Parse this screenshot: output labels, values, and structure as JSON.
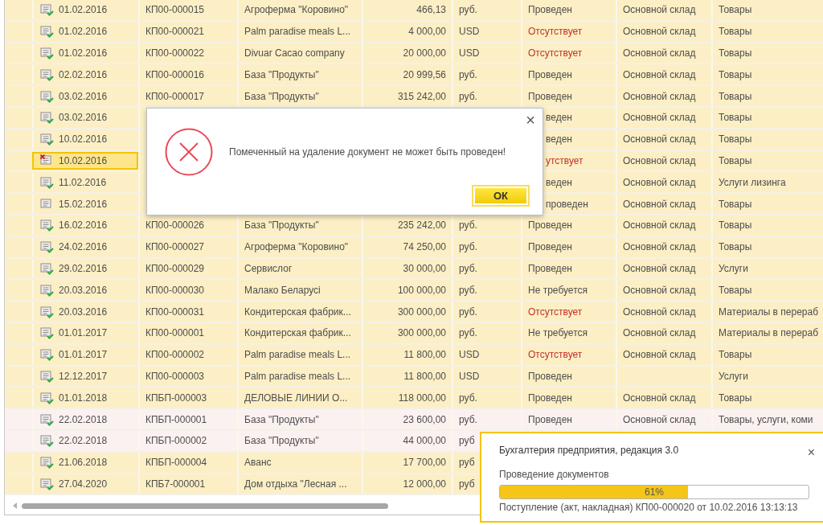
{
  "table": {
    "rows": [
      {
        "kind": "posted",
        "selected": false,
        "tinted": false,
        "date": "01.02.2016",
        "number": "КП00-000015",
        "counterparty": "Агроферма \"Коровино\"",
        "amount": "466,13",
        "currency": "руб.",
        "status": "Проведен",
        "status_alert": false,
        "warehouse": "Основной склад",
        "type": "Товары"
      },
      {
        "kind": "posted",
        "selected": false,
        "tinted": false,
        "date": "01.02.2016",
        "number": "КП00-000021",
        "counterparty": "Palm paradise meals L...",
        "amount": "4 000,00",
        "currency": "USD",
        "status": "Отсутствует",
        "status_alert": true,
        "warehouse": "Основной склад",
        "type": "Товары"
      },
      {
        "kind": "posted",
        "selected": false,
        "tinted": false,
        "date": "01.02.2016",
        "number": "КП00-000022",
        "counterparty": "Divuar Cacao company",
        "amount": "20 000,00",
        "currency": "USD",
        "status": "Отсутствует",
        "status_alert": true,
        "warehouse": "Основной склад",
        "type": "Товары"
      },
      {
        "kind": "posted",
        "selected": false,
        "tinted": false,
        "date": "02.02.2016",
        "number": "КП00-000016",
        "counterparty": "База \"Продукты\"",
        "amount": "20 999,56",
        "currency": "руб.",
        "status": "Проведен",
        "status_alert": false,
        "warehouse": "Основной склад",
        "type": "Товары"
      },
      {
        "kind": "posted",
        "selected": false,
        "tinted": false,
        "date": "03.02.2016",
        "number": "КП00-000017",
        "counterparty": "База \"Продукты\"",
        "amount": "315 242,00",
        "currency": "руб.",
        "status": "Проведен",
        "status_alert": false,
        "warehouse": "Основной склад",
        "type": "Товары"
      },
      {
        "kind": "posted",
        "selected": false,
        "tinted": false,
        "date": "03.02.2016",
        "status_tail": "веден",
        "status_alert": false,
        "warehouse": "Основной склад",
        "type": "Товары"
      },
      {
        "kind": "posted",
        "selected": false,
        "tinted": false,
        "date": "10.02.2016",
        "status_tail": "веден",
        "status_alert": false,
        "warehouse": "Основной склад",
        "type": "Товары"
      },
      {
        "kind": "deleted",
        "selected": true,
        "tinted": false,
        "date": "10.02.2016",
        "status_tail": "утствует",
        "status_alert": true,
        "warehouse": "Основной склад",
        "type": "Товары"
      },
      {
        "kind": "posted",
        "selected": false,
        "tinted": false,
        "date": "11.02.2016",
        "status_tail": "веден",
        "status_alert": false,
        "warehouse": "Основной склад",
        "type": "Услуги лизинга"
      },
      {
        "kind": "unposted",
        "selected": false,
        "tinted": false,
        "date": "15.02.2016",
        "status_tail": "проведен",
        "status_alert": false,
        "warehouse": "Основной склад",
        "type": "Товары"
      },
      {
        "kind": "posted",
        "selected": false,
        "tinted": false,
        "date": "16.02.2016",
        "number": "КП00-000026",
        "counterparty": "База \"Продукты\"",
        "amount": "235 242,00",
        "currency": "руб.",
        "status": "Проведен",
        "status_alert": false,
        "warehouse": "Основной склад",
        "type": "Товары"
      },
      {
        "kind": "posted",
        "selected": false,
        "tinted": false,
        "date": "24.02.2016",
        "number": "КП00-000027",
        "counterparty": "Агроферма \"Коровино\"",
        "amount": "74 250,00",
        "currency": "руб.",
        "status": "Проведен",
        "status_alert": false,
        "warehouse": "Основной склад",
        "type": "Товары"
      },
      {
        "kind": "posted",
        "selected": false,
        "tinted": false,
        "date": "29.02.2016",
        "number": "КП00-000029",
        "counterparty": "Сервислог",
        "amount": "30 000,00",
        "currency": "руб.",
        "status": "Проведен",
        "status_alert": false,
        "warehouse": "Основной склад",
        "type": "Услуги"
      },
      {
        "kind": "posted",
        "selected": false,
        "tinted": false,
        "date": "20.03.2016",
        "number": "КП00-000030",
        "counterparty": "Малако Беларусі",
        "amount": "100 000,00",
        "currency": "руб.",
        "status": "Не требуется",
        "status_alert": false,
        "warehouse": "Основной склад",
        "type": "Товары"
      },
      {
        "kind": "posted",
        "selected": false,
        "tinted": false,
        "date": "20.03.2016",
        "number": "КП00-000031",
        "counterparty": "Кондитерская фабрик...",
        "amount": "300 000,00",
        "currency": "руб.",
        "status": "Отсутствует",
        "status_alert": true,
        "warehouse": "Основной склад",
        "type": "Материалы в перераб"
      },
      {
        "kind": "posted",
        "selected": false,
        "tinted": false,
        "date": "01.01.2017",
        "number": "КП00-000001",
        "counterparty": "Кондитерская фабрик...",
        "amount": "300 000,00",
        "currency": "руб.",
        "status": "Не требуется",
        "status_alert": false,
        "warehouse": "Основной склад",
        "type": "Материалы в перераб"
      },
      {
        "kind": "posted",
        "selected": false,
        "tinted": false,
        "date": "01.01.2017",
        "number": "КП00-000002",
        "counterparty": "Palm paradise meals L...",
        "amount": "11 800,00",
        "currency": "USD",
        "status": "Отсутствует",
        "status_alert": true,
        "warehouse": "Основной склад",
        "type": "Товары"
      },
      {
        "kind": "posted",
        "selected": false,
        "tinted": false,
        "date": "12.12.2017",
        "number": "КП00-000003",
        "counterparty": "Palm paradise meals L...",
        "amount": "11 800,00",
        "currency": "USD",
        "status": "Проведен",
        "status_alert": false,
        "type": "Услуги"
      },
      {
        "kind": "posted",
        "selected": false,
        "tinted": false,
        "date": "01.01.2018",
        "number": "КПБП-000003",
        "counterparty": "ДЕЛОВЫЕ ЛИНИИ О...",
        "amount": "118 000,00",
        "currency": "руб.",
        "status": "Проведен",
        "status_alert": false,
        "warehouse": "Основной склад",
        "type": "Товары"
      },
      {
        "kind": "posted",
        "selected": false,
        "tinted": true,
        "date": "22.02.2018",
        "number": "КПБП-000001",
        "counterparty": "База \"Продукты\"",
        "amount": "23 600,00",
        "currency": "руб.",
        "status": "Проведен",
        "status_alert": false,
        "warehouse": "Основной склад",
        "type": "Товары, услуги, коми"
      },
      {
        "kind": "posted",
        "selected": false,
        "tinted": true,
        "date": "22.02.2018",
        "number": "КПБП-000002",
        "counterparty": "База \"Продукты\"",
        "amount": "44 000,00",
        "currency": "руб"
      },
      {
        "kind": "posted",
        "selected": false,
        "tinted": false,
        "date": "21.06.2018",
        "number": "КПБП-000004",
        "counterparty": "Аванс",
        "amount": "17 700,00",
        "currency": "руб"
      },
      {
        "kind": "posted",
        "selected": false,
        "tinted": false,
        "date": "27.04.2020",
        "number": "КПБ7-000001",
        "counterparty": "Дом отдыха \"Лесная ...",
        "amount": "12 000,00",
        "currency": "руб"
      }
    ]
  },
  "dialog": {
    "message": "Помеченный на удаление документ не может быть проведен!",
    "close": "×",
    "button": "ОК"
  },
  "progress": {
    "title": "Бухгалтерия предприятия, редакция 3.0",
    "close": "×",
    "label": "Проведение документов",
    "level": 0.61,
    "percent": "61%",
    "detail": "Поступление (акт, накладная) КП00-000020 от 10.02.2016 13:13:13"
  }
}
